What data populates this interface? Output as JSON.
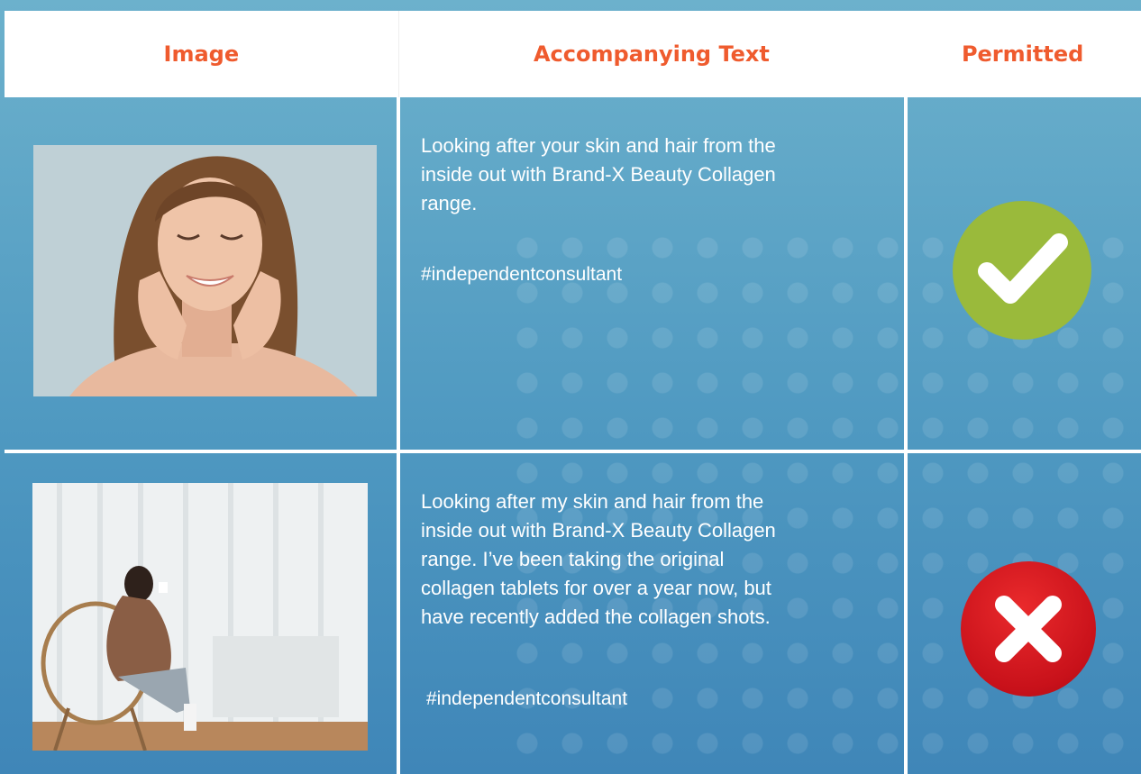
{
  "header": {
    "col_image": "Image",
    "col_text": "Accompanying Text",
    "col_permitted": "Permitted"
  },
  "rows": [
    {
      "image_alt": "Woman with eyes closed touching her face",
      "text": "Looking after your skin and hair from the\ninside out with Brand-X Beauty Collagen\nrange.",
      "hashtag": "#independentconsultant",
      "permitted_icon": "check-icon",
      "status_color": "#9aba3b"
    },
    {
      "image_alt": "Woman sitting in a chair by a window holding a cup",
      "text": "Looking after my skin and hair from the\ninside out with Brand-X Beauty Collagen\nrange. I’ve been taking the original\ncollagen tablets for over a year now, but\nhave recently added the collagen shots.",
      "hashtag": "#independentconsultant",
      "permitted_icon": "cross-icon",
      "status_color": "#d0141c"
    }
  ]
}
